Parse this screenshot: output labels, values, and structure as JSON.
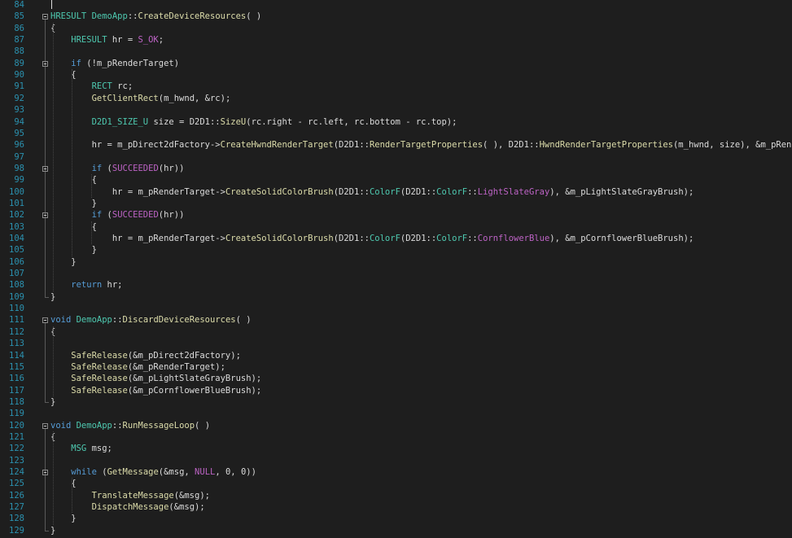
{
  "editor": {
    "lines": [
      {
        "n": "84",
        "tokens": []
      },
      {
        "n": "85",
        "tokens": [
          {
            "t": "HRESULT ",
            "c": "ty"
          },
          {
            "t": "DemoApp",
            "c": "ty"
          },
          {
            "t": "::",
            "c": "id"
          },
          {
            "t": "CreateDeviceResources",
            "c": "fn"
          },
          {
            "t": "( )",
            "c": "id"
          }
        ]
      },
      {
        "n": "86",
        "tokens": [
          {
            "t": "{",
            "c": "id"
          }
        ]
      },
      {
        "n": "87",
        "tokens": [
          {
            "t": "    HRESULT ",
            "c": "ty"
          },
          {
            "t": "hr = ",
            "c": "id"
          },
          {
            "t": "S_OK",
            "c": "mc"
          },
          {
            "t": ";",
            "c": "id"
          }
        ]
      },
      {
        "n": "88",
        "tokens": []
      },
      {
        "n": "89",
        "tokens": [
          {
            "t": "    if",
            "c": "kw"
          },
          {
            "t": " (!m_pRenderTarget)",
            "c": "id"
          }
        ]
      },
      {
        "n": "90",
        "tokens": [
          {
            "t": "    {",
            "c": "id"
          }
        ]
      },
      {
        "n": "91",
        "tokens": [
          {
            "t": "        RECT ",
            "c": "ty"
          },
          {
            "t": "rc;",
            "c": "id"
          }
        ]
      },
      {
        "n": "92",
        "tokens": [
          {
            "t": "        GetClientRect",
            "c": "fn"
          },
          {
            "t": "(m_hwnd, &rc);",
            "c": "id"
          }
        ]
      },
      {
        "n": "93",
        "tokens": []
      },
      {
        "n": "94",
        "tokens": [
          {
            "t": "        D2D1_SIZE_U ",
            "c": "ty"
          },
          {
            "t": "size = D2D1",
            "c": "id"
          },
          {
            "t": "::",
            "c": "id"
          },
          {
            "t": "SizeU",
            "c": "fn"
          },
          {
            "t": "(rc.right - rc.left, rc.bottom - rc.top);",
            "c": "id"
          }
        ]
      },
      {
        "n": "95",
        "tokens": []
      },
      {
        "n": "96",
        "tokens": [
          {
            "t": "        hr = m_pDirect2dFactory->",
            "c": "id"
          },
          {
            "t": "CreateHwndRenderTarget",
            "c": "fn"
          },
          {
            "t": "(D2D1",
            "c": "id"
          },
          {
            "t": "::",
            "c": "id"
          },
          {
            "t": "RenderTargetProperties",
            "c": "fn"
          },
          {
            "t": "( ), D2D1",
            "c": "id"
          },
          {
            "t": "::",
            "c": "id"
          },
          {
            "t": "HwndRenderTargetProperties",
            "c": "fn"
          },
          {
            "t": "(m_hwnd, size), &m_pRenderTarget);",
            "c": "id"
          }
        ]
      },
      {
        "n": "97",
        "tokens": []
      },
      {
        "n": "98",
        "tokens": [
          {
            "t": "        if",
            "c": "kw"
          },
          {
            "t": " (",
            "c": "id"
          },
          {
            "t": "SUCCEEDED",
            "c": "mc"
          },
          {
            "t": "(hr))",
            "c": "id"
          }
        ]
      },
      {
        "n": "99",
        "tokens": [
          {
            "t": "        {",
            "c": "id"
          }
        ]
      },
      {
        "n": "100",
        "tokens": [
          {
            "t": "            hr = m_pRenderTarget->",
            "c": "id"
          },
          {
            "t": "CreateSolidColorBrush",
            "c": "fn"
          },
          {
            "t": "(D2D1",
            "c": "id"
          },
          {
            "t": "::",
            "c": "id"
          },
          {
            "t": "ColorF",
            "c": "ty"
          },
          {
            "t": "(D2D1",
            "c": "id"
          },
          {
            "t": "::",
            "c": "id"
          },
          {
            "t": "ColorF",
            "c": "ty"
          },
          {
            "t": "::",
            "c": "id"
          },
          {
            "t": "LightSlateGray",
            "c": "mc"
          },
          {
            "t": "), &m_pLightSlateGrayBrush);",
            "c": "id"
          }
        ]
      },
      {
        "n": "101",
        "tokens": [
          {
            "t": "        }",
            "c": "id"
          }
        ]
      },
      {
        "n": "102",
        "tokens": [
          {
            "t": "        if",
            "c": "kw"
          },
          {
            "t": " (",
            "c": "id"
          },
          {
            "t": "SUCCEEDED",
            "c": "mc"
          },
          {
            "t": "(hr))",
            "c": "id"
          }
        ]
      },
      {
        "n": "103",
        "tokens": [
          {
            "t": "        {",
            "c": "id"
          }
        ]
      },
      {
        "n": "104",
        "tokens": [
          {
            "t": "            hr = m_pRenderTarget->",
            "c": "id"
          },
          {
            "t": "CreateSolidColorBrush",
            "c": "fn"
          },
          {
            "t": "(D2D1",
            "c": "id"
          },
          {
            "t": "::",
            "c": "id"
          },
          {
            "t": "ColorF",
            "c": "ty"
          },
          {
            "t": "(D2D1",
            "c": "id"
          },
          {
            "t": "::",
            "c": "id"
          },
          {
            "t": "ColorF",
            "c": "ty"
          },
          {
            "t": "::",
            "c": "id"
          },
          {
            "t": "CornflowerBlue",
            "c": "mc"
          },
          {
            "t": "), &m_pCornflowerBlueBrush);",
            "c": "id"
          }
        ]
      },
      {
        "n": "105",
        "tokens": [
          {
            "t": "        }",
            "c": "id"
          }
        ]
      },
      {
        "n": "106",
        "tokens": [
          {
            "t": "    }",
            "c": "id"
          }
        ]
      },
      {
        "n": "107",
        "tokens": []
      },
      {
        "n": "108",
        "tokens": [
          {
            "t": "    return",
            "c": "kw"
          },
          {
            "t": " hr;",
            "c": "id"
          }
        ]
      },
      {
        "n": "109",
        "tokens": [
          {
            "t": "}",
            "c": "id"
          }
        ]
      },
      {
        "n": "110",
        "tokens": []
      },
      {
        "n": "111",
        "tokens": [
          {
            "t": "void ",
            "c": "kw"
          },
          {
            "t": "DemoApp",
            "c": "ty"
          },
          {
            "t": "::",
            "c": "id"
          },
          {
            "t": "DiscardDeviceResources",
            "c": "fn"
          },
          {
            "t": "( )",
            "c": "id"
          }
        ]
      },
      {
        "n": "112",
        "tokens": [
          {
            "t": "{",
            "c": "id"
          }
        ]
      },
      {
        "n": "113",
        "tokens": []
      },
      {
        "n": "114",
        "tokens": [
          {
            "t": "    SafeRelease",
            "c": "fn"
          },
          {
            "t": "(&m_pDirect2dFactory);",
            "c": "id"
          }
        ]
      },
      {
        "n": "115",
        "tokens": [
          {
            "t": "    SafeRelease",
            "c": "fn"
          },
          {
            "t": "(&m_pRenderTarget);",
            "c": "id"
          }
        ]
      },
      {
        "n": "116",
        "tokens": [
          {
            "t": "    SafeRelease",
            "c": "fn"
          },
          {
            "t": "(&m_pLightSlateGrayBrush);",
            "c": "id"
          }
        ]
      },
      {
        "n": "117",
        "tokens": [
          {
            "t": "    SafeRelease",
            "c": "fn"
          },
          {
            "t": "(&m_pCornflowerBlueBrush);",
            "c": "id"
          }
        ]
      },
      {
        "n": "118",
        "tokens": [
          {
            "t": "}",
            "c": "id"
          }
        ]
      },
      {
        "n": "119",
        "tokens": []
      },
      {
        "n": "120",
        "tokens": [
          {
            "t": "void ",
            "c": "kw"
          },
          {
            "t": "DemoApp",
            "c": "ty"
          },
          {
            "t": "::",
            "c": "id"
          },
          {
            "t": "RunMessageLoop",
            "c": "fn"
          },
          {
            "t": "( )",
            "c": "id"
          }
        ]
      },
      {
        "n": "121",
        "tokens": [
          {
            "t": "{",
            "c": "id"
          }
        ]
      },
      {
        "n": "122",
        "tokens": [
          {
            "t": "    MSG ",
            "c": "ty"
          },
          {
            "t": "msg;",
            "c": "id"
          }
        ]
      },
      {
        "n": "123",
        "tokens": []
      },
      {
        "n": "124",
        "tokens": [
          {
            "t": "    while",
            "c": "kw"
          },
          {
            "t": " (",
            "c": "id"
          },
          {
            "t": "GetMessage",
            "c": "fn"
          },
          {
            "t": "(&msg, ",
            "c": "id"
          },
          {
            "t": "NULL",
            "c": "mc"
          },
          {
            "t": ", 0, 0))",
            "c": "id"
          }
        ]
      },
      {
        "n": "125",
        "tokens": [
          {
            "t": "    {",
            "c": "id"
          }
        ]
      },
      {
        "n": "126",
        "tokens": [
          {
            "t": "        TranslateMessage",
            "c": "fn"
          },
          {
            "t": "(&msg);",
            "c": "id"
          }
        ]
      },
      {
        "n": "127",
        "tokens": [
          {
            "t": "        DispatchMessage",
            "c": "fn"
          },
          {
            "t": "(&msg);",
            "c": "id"
          }
        ]
      },
      {
        "n": "128",
        "tokens": [
          {
            "t": "    }",
            "c": "id"
          }
        ]
      },
      {
        "n": "129",
        "tokens": [
          {
            "t": "}",
            "c": "id"
          }
        ]
      }
    ]
  },
  "colors": {
    "background": "#1e1e1e",
    "line_number": "#2b91af",
    "keyword": "#569cd6",
    "type": "#4ec9b0",
    "macro": "#bd63c5",
    "function": "#dcdcaa",
    "identifier": "#dcdcdc"
  },
  "icons": {
    "fold_marker": "collapse-box-icon"
  }
}
